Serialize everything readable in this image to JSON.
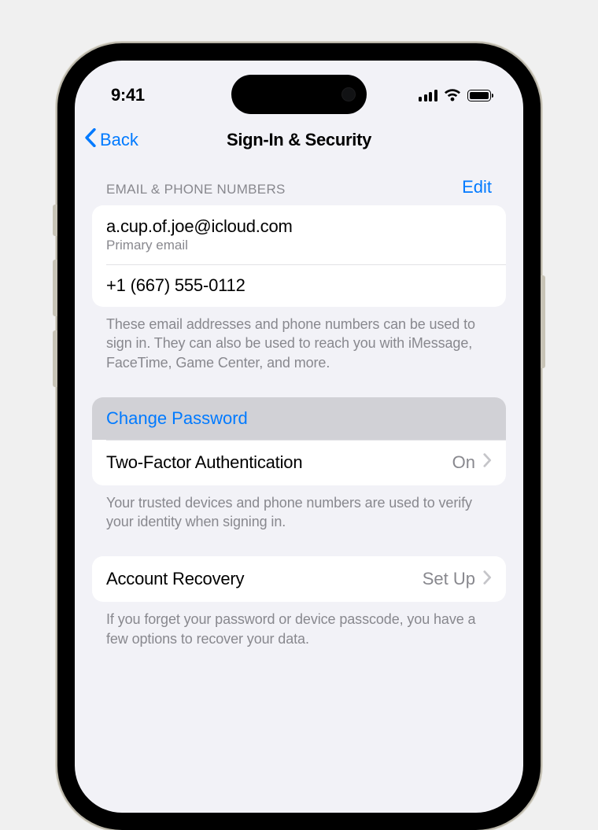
{
  "status_bar": {
    "time": "9:41"
  },
  "nav": {
    "back_label": "Back",
    "title": "Sign-In & Security"
  },
  "section_contacts": {
    "header": "Email & Phone Numbers",
    "edit_label": "Edit",
    "email": "a.cup.of.joe@icloud.com",
    "email_subtitle": "Primary email",
    "phone": "+1 (667) 555-0112",
    "footer": "These email addresses and phone numbers can be used to sign in. They can also be used to reach you with iMessage, FaceTime, Game Center, and more."
  },
  "section_password": {
    "change_password_label": "Change Password",
    "two_factor_label": "Two-Factor Authentication",
    "two_factor_value": "On",
    "footer": "Your trusted devices and phone numbers are used to verify your identity when signing in."
  },
  "section_recovery": {
    "label": "Account Recovery",
    "value": "Set Up",
    "footer": "If you forget your password or device passcode, you have a few options to recover your data."
  }
}
